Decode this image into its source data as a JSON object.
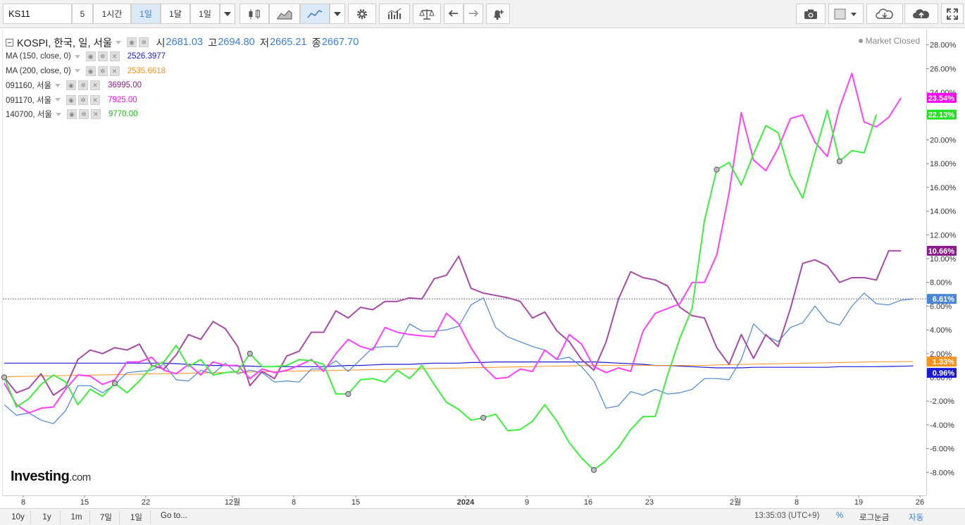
{
  "toolbar": {
    "symbol": "KS11",
    "interval_5": "5",
    "interval_1h": "1시간",
    "interval_1d": "1일",
    "interval_1mo": "1달",
    "interval_select": "1일"
  },
  "legend": {
    "main": {
      "name": "KOSPI, 한국, 일, 서울",
      "open_label": "시",
      "open": "2681.03",
      "high_label": "고",
      "high": "2694.80",
      "low_label": "저",
      "low": "2665.21",
      "close_label": "종",
      "close": "2667.70"
    },
    "items": [
      {
        "label": "MA (150, close, 0)",
        "value": "2526.3977",
        "color": "#1a1ad6"
      },
      {
        "label": "MA (200, close, 0)",
        "value": "2535.6618",
        "color": "#f7921e"
      },
      {
        "label": "091160, 서울",
        "value": "36995.00",
        "color": "#8b1a8b"
      },
      {
        "label": "091170, 서울",
        "value": "7925.00",
        "color": "#ff00ff"
      },
      {
        "label": "140700, 서울",
        "value": "9770.00",
        "color": "#16c216"
      }
    ]
  },
  "status": "Market Closed",
  "logo": {
    "main": "Investing",
    "suffix": ".com"
  },
  "bottom": {
    "ranges": [
      "10y",
      "1y",
      "1m",
      "7일",
      "1일"
    ],
    "goto": "Go to...",
    "time": "13:35:03 (UTC+9)",
    "percent": "%",
    "log": "로그눈금",
    "auto": "자동"
  },
  "chart_data": {
    "type": "line",
    "y_unit": "%",
    "ylim": [
      -9.9,
      29.3
    ],
    "y_ticks": [
      -8,
      -6,
      -4,
      -2,
      0,
      2,
      4,
      6,
      8,
      10,
      12,
      14,
      16,
      18,
      20,
      22,
      24,
      26,
      28
    ],
    "y_tick_labels": [
      "-8.00%",
      "-6.00%",
      "-4.00%",
      "-2.00%",
      "0.00%",
      "2.00%",
      "4.00%",
      "6.00%",
      "8.00%",
      "10.00%",
      "12.00%",
      "14.00%",
      "16.00%",
      "18.00%",
      "20.00%",
      "22.00%",
      "24.00%",
      "26.00%",
      "28.00%"
    ],
    "x_ticks": [
      "8",
      "15",
      "22",
      "12월",
      "8",
      "15",
      "2024",
      "9",
      "16",
      "23",
      "2월",
      "8",
      "19",
      "26"
    ],
    "last_price_line": 6.61,
    "series": [
      {
        "name": "KOSPI",
        "color": "#4a86d6",
        "width": 1.2,
        "badge": "6.61%",
        "values": [
          -2.3,
          -3.2,
          -3.0,
          -3.6,
          -3.9,
          -2.8,
          -0.7,
          -0.7,
          -1.3,
          -0.6,
          0.4,
          0.5,
          0.6,
          1.1,
          -0.2,
          -0.3,
          0.6,
          0.3,
          1.2,
          0.3,
          0.6,
          0.4,
          -0.4,
          -0.3,
          -0.4,
          0.7,
          0.7,
          1.4,
          0.5,
          1.5,
          2.5,
          2.6,
          2.6,
          4.5,
          3.9,
          3.9,
          4.0,
          4.3,
          6.1,
          6.7,
          4.2,
          3.4,
          3.0,
          2.6,
          2.3,
          1.5,
          1.7,
          0.9,
          -0.3,
          -2.6,
          -2.4,
          -1.2,
          -1.5,
          -1.0,
          -1.4,
          -1.3,
          -1.0,
          -0.1,
          -0.1,
          -0.2,
          1.5,
          4.5,
          3.5,
          3.0,
          4.2,
          4.6,
          6.0,
          4.7,
          4.4,
          6.0,
          7.1,
          6.2,
          6.1,
          6.5,
          6.61
        ]
      },
      {
        "name": "MA (150, close, 0)",
        "color": "#1a1ad6",
        "width": 1.2,
        "badge": "0.96%",
        "values": [
          1.2,
          1.2,
          1.2,
          1.2,
          1.2,
          1.2,
          1.2,
          1.2,
          1.2,
          1.2,
          1.2,
          1.2,
          1.2,
          1.2,
          1.15,
          1.1,
          1.05,
          1.0,
          1.0,
          0.95,
          0.95,
          0.9,
          0.9,
          0.9,
          0.9,
          0.9,
          0.9,
          0.95,
          1.0,
          1.0,
          1.05,
          1.1,
          1.1,
          1.1,
          1.15,
          1.2,
          1.2,
          1.2,
          1.25,
          1.25,
          1.3,
          1.3,
          1.3,
          1.3,
          1.3,
          1.3,
          1.3,
          1.3,
          1.3,
          1.25,
          1.2,
          1.15,
          1.1,
          1.0,
          1.0,
          0.95,
          0.9,
          0.85,
          0.8,
          0.8,
          0.8,
          0.85,
          0.85,
          0.85,
          0.85,
          0.85,
          0.85,
          0.85,
          0.9,
          0.9,
          0.9,
          0.9,
          0.92,
          0.94,
          0.96
        ]
      },
      {
        "name": "MA (200, close, 0)",
        "color": "#f7921e",
        "width": 1.0,
        "badge": "1.33%",
        "values": [
          0.05,
          0.07,
          0.09,
          0.11,
          0.13,
          0.15,
          0.17,
          0.19,
          0.21,
          0.23,
          0.25,
          0.27,
          0.29,
          0.31,
          0.33,
          0.35,
          0.37,
          0.39,
          0.41,
          0.43,
          0.45,
          0.47,
          0.49,
          0.51,
          0.53,
          0.55,
          0.57,
          0.59,
          0.61,
          0.63,
          0.65,
          0.67,
          0.69,
          0.71,
          0.73,
          0.75,
          0.77,
          0.79,
          0.81,
          0.83,
          0.85,
          0.87,
          0.89,
          0.91,
          0.93,
          0.95,
          0.97,
          0.99,
          1.0,
          1.0,
          1.0,
          1.0,
          1.0,
          1.0,
          1.0,
          1.0,
          1.0,
          1.0,
          1.05,
          1.07,
          1.09,
          1.11,
          1.13,
          1.15,
          1.17,
          1.19,
          1.21,
          1.23,
          1.25,
          1.27,
          1.29,
          1.31,
          1.32,
          1.33,
          1.33
        ]
      },
      {
        "name": "091160, 서울",
        "color": "#a64ca6",
        "width": 2.0,
        "badge": "10.66%",
        "values": [
          0.0,
          -1.3,
          -0.9,
          0.3,
          -1.5,
          -0.8,
          1.5,
          2.3,
          2.0,
          2.5,
          2.3,
          2.8,
          1.0,
          0.7,
          1.9,
          3.6,
          3.2,
          4.7,
          4.1,
          2.6,
          -0.7,
          0.5,
          -0.1,
          1.8,
          2.2,
          3.8,
          3.8,
          5.6,
          5.0,
          5.9,
          5.7,
          6.4,
          6.4,
          6.7,
          6.6,
          8.3,
          8.6,
          10.2,
          7.5,
          7.1,
          6.9,
          6.7,
          6.4,
          5.0,
          5.5,
          3.9,
          3.0,
          1.5,
          0.6,
          3.0,
          6.6,
          8.9,
          8.4,
          8.2,
          7.7,
          5.9,
          5.2,
          5.0,
          2.5,
          1.1,
          3.6,
          1.6,
          3.6,
          2.6,
          5.8,
          9.6,
          9.9,
          9.4,
          8.0,
          8.4,
          8.4,
          8.2,
          10.66,
          10.66
        ]
      },
      {
        "name": "091170, 서울",
        "color": "#ff40ff",
        "width": 2.0,
        "badge": "23.54%",
        "values": [
          -0.5,
          -2.3,
          -3.0,
          -2.6,
          -2.5,
          -1.0,
          0.2,
          0.1,
          -0.6,
          -0.2,
          1.3,
          1.3,
          1.7,
          0.6,
          0.3,
          1.1,
          0.2,
          1.3,
          1.0,
          1.0,
          -0.1,
          0.7,
          0.4,
          0.6,
          1.0,
          1.5,
          0.5,
          2.0,
          3.2,
          2.6,
          2.3,
          4.2,
          3.8,
          3.6,
          3.5,
          3.4,
          5.4,
          4.5,
          2.5,
          0.9,
          -0.1,
          0.0,
          0.7,
          0.5,
          2.3,
          1.5,
          3.6,
          2.8,
          0.9,
          0.4,
          0.8,
          0.5,
          3.9,
          5.4,
          5.8,
          6.2,
          8.0,
          8.0,
          10.3,
          15.5,
          22.3,
          18.3,
          17.4,
          19.3,
          21.8,
          22.1,
          19.8,
          18.6,
          22.7,
          25.6,
          21.5,
          21.1,
          21.9,
          23.54
        ]
      },
      {
        "name": "140700, 서울",
        "color": "#3cf03c",
        "width": 2.0,
        "badge": "22.13%",
        "values": [
          0.0,
          -2.5,
          -1.8,
          -0.6,
          0.2,
          -0.4,
          -2.3,
          -1.0,
          -1.6,
          -0.5,
          -1.3,
          -0.3,
          0.9,
          1.3,
          2.7,
          0.9,
          1.5,
          0.2,
          0.4,
          0.5,
          2.0,
          0.9,
          0.9,
          1.0,
          1.5,
          1.4,
          1.1,
          -1.4,
          -1.4,
          -0.2,
          -0.1,
          -0.4,
          0.6,
          -0.1,
          1.0,
          -0.6,
          -2.1,
          -2.7,
          -3.6,
          -3.4,
          -3.1,
          -4.5,
          -4.4,
          -3.7,
          -2.3,
          -3.7,
          -5.5,
          -6.8,
          -7.8,
          -7.0,
          -5.9,
          -4.4,
          -3.3,
          -3.3,
          0.2,
          3.3,
          5.8,
          13.2,
          17.5,
          18.1,
          16.2,
          18.8,
          21.2,
          20.6,
          17.0,
          15.1,
          18.9,
          22.5,
          18.2,
          19.1,
          18.9,
          22.13
        ]
      }
    ],
    "markers": [
      {
        "series": "091160, 서울",
        "x": 0
      },
      {
        "series": "140700, 서울",
        "x": 9
      },
      {
        "series": "140700, 서울",
        "x": 20
      },
      {
        "series": "140700, 서울",
        "x": 28
      },
      {
        "series": "140700, 서울",
        "x": 39
      },
      {
        "series": "140700, 서울",
        "x": 48
      },
      {
        "series": "140700, 서울",
        "x": 58
      },
      {
        "series": "140700, 서울",
        "x": 68
      }
    ]
  }
}
